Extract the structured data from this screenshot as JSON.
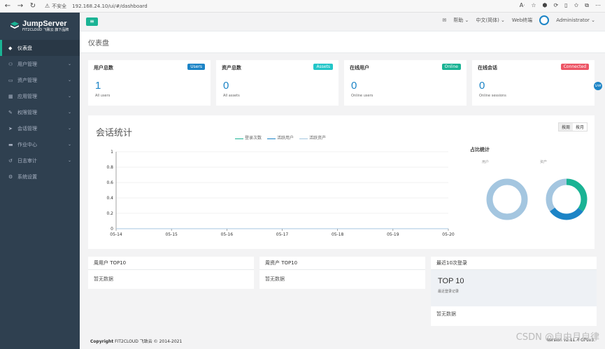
{
  "browser": {
    "security": "不安全",
    "url": "192.168.24.10/ui/#/dashboard",
    "icons": [
      "back-icon",
      "forward-icon",
      "refresh-icon"
    ]
  },
  "sidebar": {
    "brand": "JumpServer",
    "brand_sub": "FIT2CLOUD 飞致云  旗下品牌",
    "items": [
      {
        "label": "仪表盘",
        "icon": "dashboard-icon"
      },
      {
        "label": "用户管理",
        "icon": "users-icon"
      },
      {
        "label": "资产管理",
        "icon": "assets-icon"
      },
      {
        "label": "应用管理",
        "icon": "apps-icon"
      },
      {
        "label": "权限管理",
        "icon": "perms-icon"
      },
      {
        "label": "会话管理",
        "icon": "session-icon"
      },
      {
        "label": "作业中心",
        "icon": "jobs-icon"
      },
      {
        "label": "日志审计",
        "icon": "audit-icon"
      },
      {
        "label": "系统设置",
        "icon": "settings-icon"
      }
    ]
  },
  "topbar": {
    "help": "帮助",
    "language": "中文(简体)",
    "web_terminal": "Web终端",
    "user": "Administrator"
  },
  "page": {
    "title": "仪表盘"
  },
  "cards": [
    {
      "title": "用户总数",
      "badge": "Users",
      "badge_color": "#1c84c6",
      "value": "1",
      "sub": "All users"
    },
    {
      "title": "资产总数",
      "badge": "Assets",
      "badge_color": "#23c6c8",
      "value": "0",
      "sub": "All assets"
    },
    {
      "title": "在线用户",
      "badge": "Online",
      "badge_color": "#1ab394",
      "value": "0",
      "sub": "Online users"
    },
    {
      "title": "在线会话",
      "badge": "Connected",
      "badge_color": "#ed5565",
      "value": "0",
      "sub": "Online sessions"
    }
  ],
  "stats": {
    "title": "会话统计",
    "legend": [
      "登录次数",
      "活跃用户",
      "活跃资产"
    ],
    "toggle": [
      "按周",
      "按月"
    ],
    "ratio_title": "占比统计",
    "ratio_labels": [
      "用户",
      "资产"
    ]
  },
  "chart_data": {
    "type": "line",
    "x": [
      "05-14",
      "05-15",
      "05-16",
      "05-17",
      "05-18",
      "05-19",
      "05-20"
    ],
    "series": [
      {
        "name": "登录次数",
        "values": [
          0,
          0,
          0,
          0,
          0,
          0,
          0
        ]
      },
      {
        "name": "活跃用户",
        "values": [
          0,
          0,
          0,
          0,
          0,
          0,
          0
        ]
      },
      {
        "name": "活跃资产",
        "values": [
          0,
          0,
          0,
          0,
          0,
          0,
          0
        ]
      }
    ],
    "yticks": [
      "0",
      "0.2",
      "0.4",
      "0.6",
      "0.8",
      "1"
    ],
    "ylim": [
      0,
      1
    ],
    "grid": true,
    "donuts": [
      {
        "segments": [
          {
            "value": 100,
            "color": "#a4c6e0"
          }
        ]
      },
      {
        "segments": [
          {
            "value": 35,
            "color": "#1ab394"
          },
          {
            "value": 30,
            "color": "#1c84c6"
          },
          {
            "value": 35,
            "color": "#a4c6e0"
          }
        ]
      }
    ]
  },
  "bottom": {
    "week_users": {
      "title": "周用户 TOP10",
      "empty": "暂无数据"
    },
    "week_assets": {
      "title": "周资产 TOP10",
      "empty": "暂无数据"
    },
    "recent": {
      "title": "最近10次登录",
      "big": "TOP 10",
      "sub": "最近登录记录",
      "empty": "暂无数据"
    }
  },
  "footer": {
    "copyright_bold": "Copyright",
    "copyright": "FIT2CLOUD 飞致云 © 2014-2021",
    "version": "Version v2.11.4 GPLv3."
  },
  "float_btn": "SAM",
  "watermark": "CSDN @自由月自律"
}
